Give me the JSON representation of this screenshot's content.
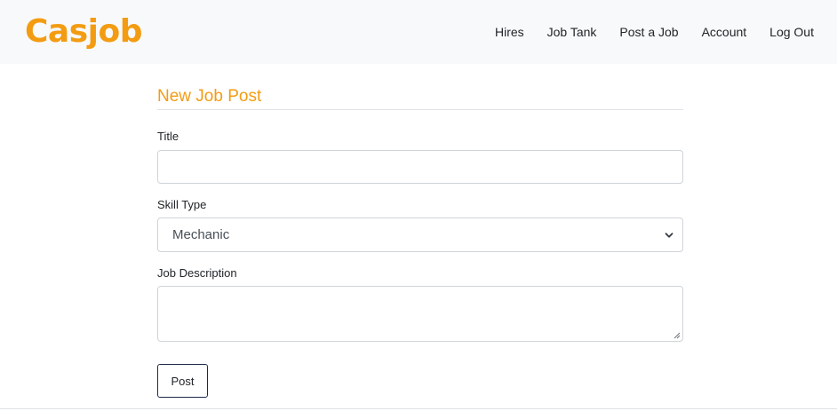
{
  "brand": {
    "name": "Casjob",
    "color": "#f39c12"
  },
  "nav": {
    "items": [
      {
        "label": "Hires"
      },
      {
        "label": "Job Tank"
      },
      {
        "label": "Post a Job"
      },
      {
        "label": "Account"
      },
      {
        "label": "Log Out"
      }
    ]
  },
  "form": {
    "heading": "New Job Post",
    "title": {
      "label": "Title",
      "value": ""
    },
    "skill_type": {
      "label": "Skill Type",
      "selected": "Mechanic",
      "icon": "chevron-down-icon"
    },
    "description": {
      "label": "Job Description",
      "value": ""
    },
    "submit_label": "Post"
  }
}
